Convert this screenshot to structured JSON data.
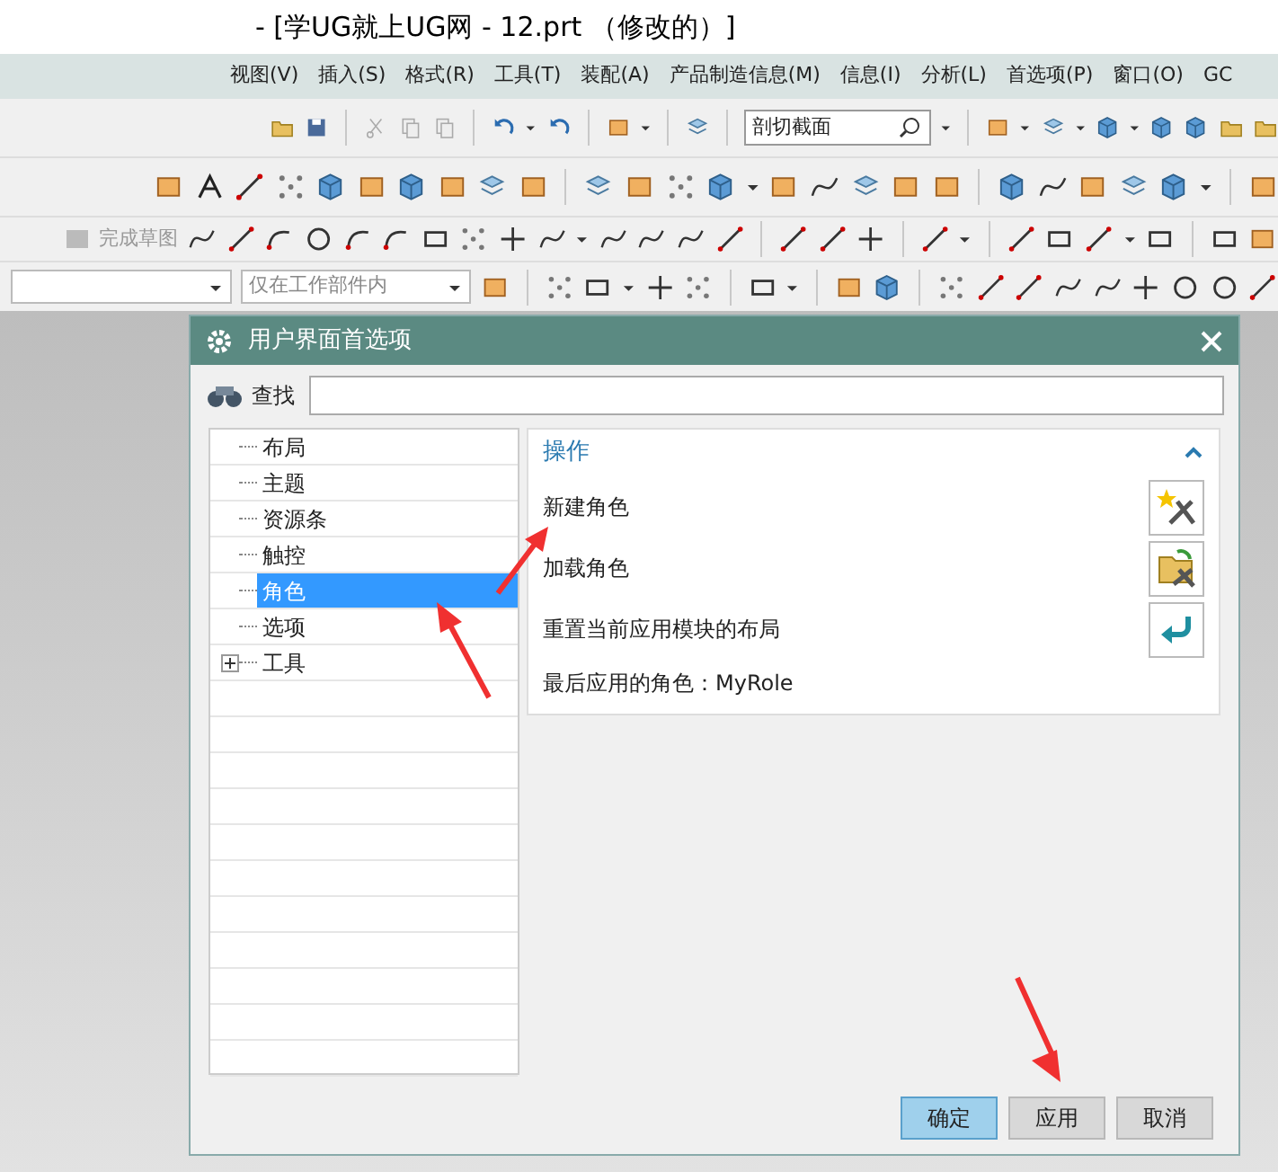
{
  "window": {
    "title": "- [学UG就上UG网 - 12.prt （修改的）]"
  },
  "menu": [
    "视图(V)",
    "插入(S)",
    "格式(R)",
    "工具(T)",
    "装配(A)",
    "产品制造信息(M)",
    "信息(I)",
    "分析(L)",
    "首选项(P)",
    "窗口(O)",
    "GC"
  ],
  "toolbar": {
    "section_field": "剖切截面",
    "finish_sketch": {
      "label": "完成草图",
      "disabled": true
    },
    "scope_filter": "仅在工作部件内"
  },
  "dialog": {
    "title": "用户界面首选项",
    "search_label": "查找",
    "tree": [
      {
        "label": "布局",
        "selected": false,
        "kind": "leaf"
      },
      {
        "label": "主题",
        "selected": false,
        "kind": "leaf"
      },
      {
        "label": "资源条",
        "selected": false,
        "kind": "leaf"
      },
      {
        "label": "触控",
        "selected": false,
        "kind": "leaf"
      },
      {
        "label": "角色",
        "selected": true,
        "kind": "leaf"
      },
      {
        "label": "选项",
        "selected": false,
        "kind": "leaf"
      },
      {
        "label": "工具",
        "selected": false,
        "kind": "folder"
      }
    ],
    "section": {
      "title": "操作",
      "expanded": true,
      "actions": [
        {
          "label": "新建角色",
          "kind": "new"
        },
        {
          "label": "加载角色",
          "kind": "load"
        },
        {
          "label": "重置当前应用模块的布局",
          "kind": "reset"
        }
      ],
      "last_role": "最后应用的角色：MyRole"
    },
    "buttons": [
      {
        "label": "确定",
        "kind": "primary"
      },
      {
        "label": "应用",
        "kind": "normal"
      },
      {
        "label": "取消",
        "kind": "normal"
      }
    ]
  }
}
